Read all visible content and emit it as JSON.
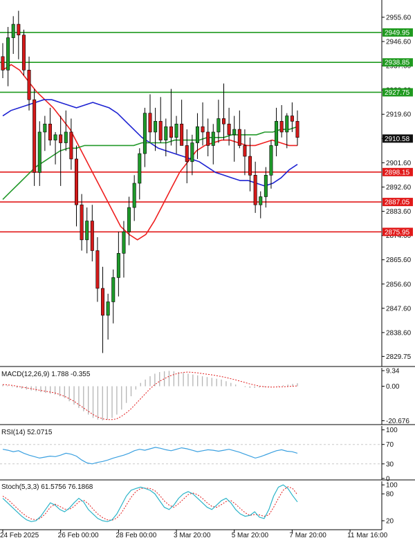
{
  "chart_data": [
    {
      "type": "candlestick",
      "panel": "price",
      "ylim": [
        2826,
        2962
      ],
      "y_ticks": [
        "2955.60",
        "2946.60",
        "2937.60",
        "2928.60",
        "2919.60",
        "2910.60",
        "2901.60",
        "2892.60",
        "2883.60",
        "2874.60",
        "2865.60",
        "2856.60",
        "2847.60",
        "2838.60",
        "2829.75"
      ],
      "current_price": "2910.58",
      "resistance_levels": [
        {
          "label": "2949.95",
          "value": 2949.95
        },
        {
          "label": "2938.85",
          "value": 2938.85
        },
        {
          "label": "2927.75",
          "value": 2927.75
        }
      ],
      "support_levels": [
        {
          "label": "2898.15",
          "value": 2898.15
        },
        {
          "label": "2887.05",
          "value": 2887.05
        },
        {
          "label": "2875.95",
          "value": 2875.95
        }
      ],
      "x_labels": [
        {
          "label": "24 Feb 2025",
          "i": 0
        },
        {
          "label": "26 Feb 00:00",
          "i": 11
        },
        {
          "label": "28 Feb 00:00",
          "i": 22
        },
        {
          "label": "3 Mar 20:00",
          "i": 33
        },
        {
          "label": "5 Mar 20:00",
          "i": 44
        },
        {
          "label": "7 Mar 20:00",
          "i": 55
        },
        {
          "label": "11 Mar 16:00",
          "i": 66
        }
      ],
      "candles": [
        [
          2941,
          2946,
          2933,
          2936
        ],
        [
          2936,
          2952,
          2930,
          2948
        ],
        [
          2948,
          2956,
          2942,
          2953
        ],
        [
          2953,
          2958,
          2940,
          2949
        ],
        [
          2949,
          2951,
          2934,
          2936
        ],
        [
          2936,
          2941,
          2921,
          2925
        ],
        [
          2925,
          2929,
          2893,
          2898
        ],
        [
          2898,
          2917,
          2893,
          2913
        ],
        [
          2913,
          2919,
          2906,
          2916
        ],
        [
          2916,
          2922,
          2908,
          2910
        ],
        [
          2910,
          2913,
          2901,
          2912
        ],
        [
          2912,
          2919,
          2893,
          2909
        ],
        [
          2909,
          2921,
          2906,
          2913
        ],
        [
          2913,
          2918,
          2899,
          2903
        ],
        [
          2903,
          2908,
          2878,
          2886
        ],
        [
          2886,
          2890,
          2869,
          2873
        ],
        [
          2873,
          2885,
          2868,
          2880
        ],
        [
          2880,
          2886,
          2865,
          2869
        ],
        [
          2869,
          2874,
          2850,
          2855
        ],
        [
          2855,
          2863,
          2831,
          2845
        ],
        [
          2845,
          2853,
          2836,
          2850
        ],
        [
          2850,
          2862,
          2842,
          2859
        ],
        [
          2859,
          2876,
          2852,
          2868
        ],
        [
          2868,
          2880,
          2859,
          2876
        ],
        [
          2876,
          2889,
          2871,
          2885
        ],
        [
          2885,
          2897,
          2880,
          2894
        ],
        [
          2894,
          2907,
          2888,
          2905
        ],
        [
          2905,
          2922,
          2900,
          2920
        ],
        [
          2920,
          2927,
          2909,
          2913
        ],
        [
          2913,
          2922,
          2906,
          2917
        ],
        [
          2917,
          2926,
          2909,
          2910
        ],
        [
          2910,
          2918,
          2904,
          2915
        ],
        [
          2915,
          2929,
          2908,
          2911
        ],
        [
          2911,
          2919,
          2905,
          2916
        ],
        [
          2916,
          2925,
          2909,
          2908
        ],
        [
          2908,
          2914,
          2894,
          2902
        ],
        [
          2902,
          2912,
          2897,
          2909
        ],
        [
          2909,
          2920,
          2903,
          2915
        ],
        [
          2915,
          2924,
          2908,
          2913
        ],
        [
          2913,
          2918,
          2904,
          2908
        ],
        [
          2908,
          2916,
          2901,
          2913
        ],
        [
          2913,
          2925,
          2909,
          2918
        ],
        [
          2918,
          2931,
          2910,
          2916
        ],
        [
          2916,
          2922,
          2908,
          2912
        ],
        [
          2912,
          2919,
          2902,
          2914
        ],
        [
          2914,
          2921,
          2907,
          2908
        ],
        [
          2908,
          2914,
          2897,
          2904
        ],
        [
          2904,
          2911,
          2891,
          2897
        ],
        [
          2897,
          2902,
          2883,
          2886
        ],
        [
          2886,
          2891,
          2881,
          2889
        ],
        [
          2889,
          2900,
          2885,
          2897
        ],
        [
          2897,
          2910,
          2892,
          2908
        ],
        [
          2908,
          2922,
          2904,
          2917
        ],
        [
          2917,
          2923,
          2911,
          2913
        ],
        [
          2913,
          2920,
          2907,
          2919
        ],
        [
          2919,
          2924,
          2913,
          2917
        ],
        [
          2917,
          2921,
          2908,
          2911
        ]
      ],
      "series": [
        {
          "name": "",
          "color": "#ef1f1f",
          "values": [
            2936,
            2938,
            2936,
            2932,
            2928,
            2925,
            2922,
            2918,
            2914,
            2908,
            2902,
            2896,
            2890,
            2884,
            2878,
            2875,
            2873,
            2875,
            2880,
            2886,
            2892,
            2898,
            2902,
            2906,
            2908,
            2909,
            2910,
            2910,
            2909,
            2908,
            2908,
            2909,
            2910,
            2909,
            2908,
            2908
          ]
        },
        {
          "name": "",
          "color": "#1d22d2",
          "values": [
            2919,
            2921,
            2922,
            2923,
            2924,
            2925,
            2925,
            2924,
            2923,
            2922,
            2923,
            2924,
            2923,
            2922,
            2920,
            2917,
            2914,
            2911,
            2909,
            2907,
            2906,
            2905,
            2904,
            2903,
            2902,
            2900,
            2898,
            2897,
            2896,
            2895,
            2895,
            2894,
            2893,
            2894,
            2896,
            2899,
            2901
          ]
        },
        {
          "name": "",
          "color": "#22992a",
          "values": [
            2888,
            2891,
            2894,
            2897,
            2900,
            2902,
            2904,
            2906,
            2907,
            2907,
            2908,
            2908,
            2908,
            2908,
            2908,
            2908,
            2908,
            2909,
            2909,
            2909,
            2909,
            2910,
            2910,
            2910,
            2910,
            2911,
            2911,
            2911,
            2912,
            2912,
            2912,
            2912,
            2913,
            2913,
            2914,
            2914,
            2915
          ]
        }
      ]
    },
    {
      "type": "histogram",
      "panel": "macd",
      "title": "MACD(12,26,9) 1.788 -0.355",
      "ylim": [
        -23,
        11
      ],
      "y_ticks": [
        {
          "label": "9.34",
          "v": 9.34
        },
        {
          "label": "0.00",
          "v": 0
        },
        {
          "label": "-20.676",
          "v": -20.676
        }
      ],
      "histogram": [
        1,
        0.5,
        -0.5,
        -1,
        -1.5,
        -2,
        -2.5,
        -3,
        -3.5,
        -4,
        -4.5,
        -5,
        -6,
        -7,
        -9,
        -11,
        -13,
        -15,
        -17,
        -19,
        -20,
        -20.5,
        -20,
        -19,
        -17,
        -14,
        -10,
        -6,
        -2,
        2,
        4,
        6,
        7.5,
        8.5,
        9,
        9.2,
        9,
        8.5,
        8,
        7.5,
        7,
        6.5,
        6,
        5.5,
        5,
        4.5,
        4,
        3,
        2,
        1,
        0,
        -0.5,
        -1,
        -1,
        -0.8,
        -0.5,
        -0.3,
        0,
        0.3,
        0.6,
        1,
        1.4,
        1.8
      ],
      "signal": [
        1,
        0.8,
        0.5,
        0,
        -0.5,
        -1,
        -1.5,
        -2,
        -2.5,
        -3,
        -3.5,
        -4,
        -5,
        -6,
        -7.5,
        -9,
        -11,
        -13,
        -15,
        -17,
        -18.5,
        -19.5,
        -20,
        -20,
        -19.5,
        -18,
        -16,
        -13.5,
        -10.5,
        -7.5,
        -4.5,
        -1.5,
        1,
        3,
        4.5,
        6,
        7,
        7.8,
        8.3,
        8.5,
        8.3,
        8,
        7.6,
        7.2,
        6.8,
        6.3,
        5.8,
        5.2,
        4.5,
        3.8,
        3,
        2.2,
        1.4,
        0.7,
        0.1,
        -0.3,
        -0.5,
        -0.5,
        -0.4,
        -0.3,
        -0.2,
        0,
        0.2
      ]
    },
    {
      "type": "line",
      "panel": "rsi",
      "title": "RSI(14) 52.0715",
      "ylim": [
        -3,
        108
      ],
      "y_ticks": [
        {
          "label": "100",
          "v": 100
        },
        {
          "label": "70",
          "v": 70
        },
        {
          "label": "30",
          "v": 30
        },
        {
          "label": "0",
          "v": 0
        }
      ],
      "values": [
        60,
        58,
        55,
        57,
        52,
        48,
        45,
        42,
        44,
        46,
        45,
        48,
        52,
        50,
        46,
        38,
        32,
        30,
        33,
        35,
        38,
        42,
        45,
        48,
        52,
        57,
        60,
        58,
        61,
        64,
        62,
        59,
        57,
        60,
        63,
        61,
        58,
        55,
        57,
        59,
        58,
        56,
        58,
        60,
        57,
        54,
        50,
        46,
        42,
        45,
        49,
        53,
        57,
        59,
        56,
        55,
        52
      ]
    },
    {
      "type": "line",
      "panel": "stochastic",
      "title": "Stoch(5,3,3) 61.5756 76.1868",
      "ylim": [
        0,
        108
      ],
      "y_ticks": [
        {
          "label": "100",
          "v": 100
        },
        {
          "label": "80",
          "v": 80
        },
        {
          "label": "20",
          "v": 20
        }
      ],
      "k": [
        70,
        60,
        50,
        40,
        30,
        22,
        18,
        20,
        30,
        45,
        60,
        55,
        45,
        40,
        48,
        60,
        70,
        62,
        45,
        35,
        25,
        20,
        18,
        22,
        35,
        55,
        75,
        88,
        92,
        95,
        92,
        88,
        80,
        65,
        50,
        45,
        55,
        70,
        80,
        85,
        80,
        70,
        60,
        50,
        45,
        55,
        65,
        70,
        60,
        45,
        35,
        30,
        32,
        40,
        28,
        25,
        45,
        75,
        95,
        100,
        92,
        76,
        62
      ],
      "d": [
        75,
        68,
        58,
        48,
        38,
        30,
        24,
        22,
        26,
        36,
        50,
        57,
        52,
        46,
        45,
        52,
        62,
        66,
        58,
        46,
        35,
        27,
        22,
        21,
        26,
        38,
        55,
        72,
        85,
        92,
        93,
        92,
        87,
        77,
        64,
        55,
        50,
        58,
        68,
        78,
        82,
        78,
        70,
        60,
        52,
        50,
        56,
        63,
        65,
        57,
        47,
        38,
        32,
        34,
        33,
        30,
        33,
        50,
        70,
        88,
        96,
        92,
        78
      ]
    }
  ]
}
